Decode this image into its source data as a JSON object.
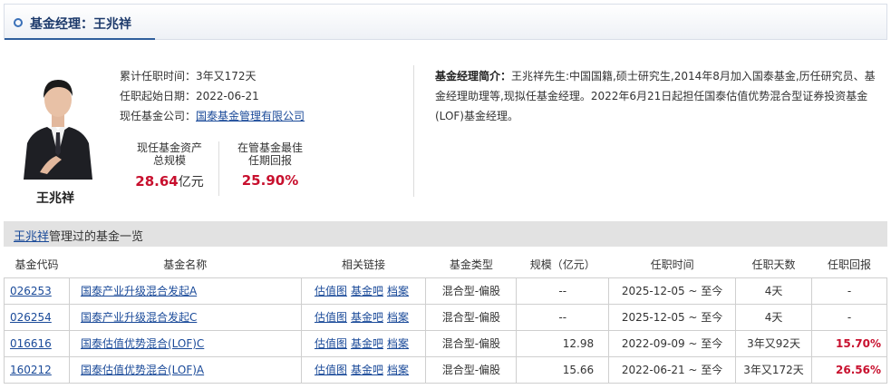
{
  "header": {
    "title": "基金经理：王兆祥"
  },
  "manager": {
    "name": "王兆祥",
    "info": [
      {
        "label": "累计任职时间：",
        "value": "3年又172天"
      },
      {
        "label": "任职起始日期：",
        "value": "2022-06-21"
      },
      {
        "label": "现任基金公司：",
        "value": "国泰基金管理有限公司"
      }
    ],
    "stats": [
      {
        "label_line1": "现任基金资产",
        "label_line2": "总规模",
        "value": "28.64",
        "unit": "亿元"
      },
      {
        "label_line1": "在管基金最佳",
        "label_line2": "任期回报",
        "value": "25.90%",
        "unit": ""
      }
    ],
    "intro_label": "基金经理简介：",
    "intro_text": "王兆祥先生:中国国籍,硕士研究生,2014年8月加入国泰基金,历任研究员、基金经理助理等,现拟任基金经理。2022年6月21日起担任国泰估值优势混合型证券投资基金(LOF)基金经理。"
  },
  "section": {
    "name": "王兆祥",
    "suffix": "管理过的基金一览"
  },
  "table": {
    "headers": [
      "基金代码",
      "基金名称",
      "相关链接",
      "基金类型",
      "规模（亿元）",
      "任职时间",
      "任职天数",
      "任职回报"
    ],
    "links": [
      "估值图",
      "基金吧",
      "档案"
    ],
    "rows": [
      {
        "code": "026253",
        "name": "国泰产业升级混合发起A",
        "type": "混合型-偏股",
        "size": "--",
        "period": "2025-12-05 ~ 至今",
        "days": "4天",
        "ret": "-"
      },
      {
        "code": "026254",
        "name": "国泰产业升级混合发起C",
        "type": "混合型-偏股",
        "size": "--",
        "period": "2025-12-05 ~ 至今",
        "days": "4天",
        "ret": "-"
      },
      {
        "code": "016616",
        "name": "国泰估值优势混合(LOF)C",
        "type": "混合型-偏股",
        "size": "12.98",
        "period": "2022-09-09 ~ 至今",
        "days": "3年又92天",
        "ret": "15.70%"
      },
      {
        "code": "160212",
        "name": "国泰估值优势混合(LOF)A",
        "type": "混合型-偏股",
        "size": "15.66",
        "period": "2022-06-21 ~ 至今",
        "days": "3年又172天",
        "ret": "26.56%"
      }
    ]
  }
}
